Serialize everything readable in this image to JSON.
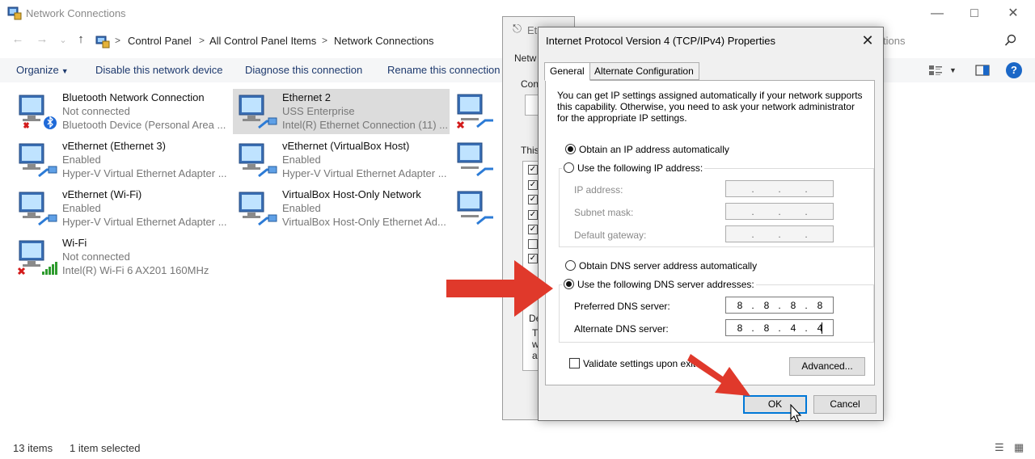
{
  "explorer": {
    "title": "Network Connections",
    "breadcrumb": [
      "Control Panel",
      "All Control Panel Items",
      "Network Connections"
    ],
    "search_placeholder": "tions"
  },
  "commands": {
    "organize": "Organize",
    "disable": "Disable this network device",
    "diagnose": "Diagnose this connection",
    "rename": "Rename this connection"
  },
  "adapters": [
    {
      "name": "Bluetooth Network Connection",
      "status": "Not connected",
      "device": "Bluetooth Device (Personal Area ..."
    },
    {
      "name": "Ethernet 2",
      "status": "USS Enterprise",
      "device": "Intel(R) Ethernet Connection (11) ..."
    },
    {
      "name": "vEthernet (Ethernet 3)",
      "status": "Enabled",
      "device": "Hyper-V Virtual Ethernet Adapter ..."
    },
    {
      "name": "vEthernet (VirtualBox Host)",
      "status": "Enabled",
      "device": "Hyper-V Virtual Ethernet Adapter ..."
    },
    {
      "name": "vEthernet (Wi-Fi)",
      "status": "Enabled",
      "device": "Hyper-V Virtual Ethernet Adapter ..."
    },
    {
      "name": "VirtualBox Host-Only Network",
      "status": "Enabled",
      "device": "VirtualBox Host-Only Ethernet Ad..."
    },
    {
      "name": "Wi-Fi",
      "status": "Not connected",
      "device": "Intel(R) Wi-Fi 6 AX201 160MHz"
    }
  ],
  "status_bar": {
    "items": "13 items",
    "selected": "1 item selected"
  },
  "bg_dialog": {
    "title": "Et",
    "tab": "Netw",
    "conn": "Con",
    "this": "This",
    "de": "De",
    "frag_t": "T",
    "frag_w": "w",
    "frag_a": "a"
  },
  "dialog": {
    "title": "Internet Protocol Version 4 (TCP/IPv4) Properties",
    "tabs": [
      "General",
      "Alternate Configuration"
    ],
    "description": "You can get IP settings assigned automatically if your network supports this capability. Otherwise, you need to ask your network administrator for the appropriate IP settings.",
    "obtain_ip_auto": "Obtain an IP address automatically",
    "use_following_ip": "Use the following IP address:",
    "ip_address_label": "IP address:",
    "subnet_mask_label": "Subnet mask:",
    "default_gateway_label": "Default gateway:",
    "obtain_dns_auto": "Obtain DNS server address automatically",
    "use_following_dns": "Use the following DNS server addresses:",
    "preferred_dns_label": "Preferred DNS server:",
    "alternate_dns_label": "Alternate DNS server:",
    "preferred_dns": [
      "8",
      "8",
      "8",
      "8"
    ],
    "alternate_dns": [
      "8",
      "8",
      "4",
      "4"
    ],
    "ip_selected_mode": "automatic",
    "dns_selected_mode": "manual",
    "validate_label": "Validate settings upon exit",
    "advanced_button": "Advanced...",
    "ok_button": "OK",
    "cancel_button": "Cancel"
  },
  "colors": {
    "arrow_red": "#e0392b",
    "accent_blue": "#0078d7",
    "selection_gray": "#dcdcdc"
  }
}
